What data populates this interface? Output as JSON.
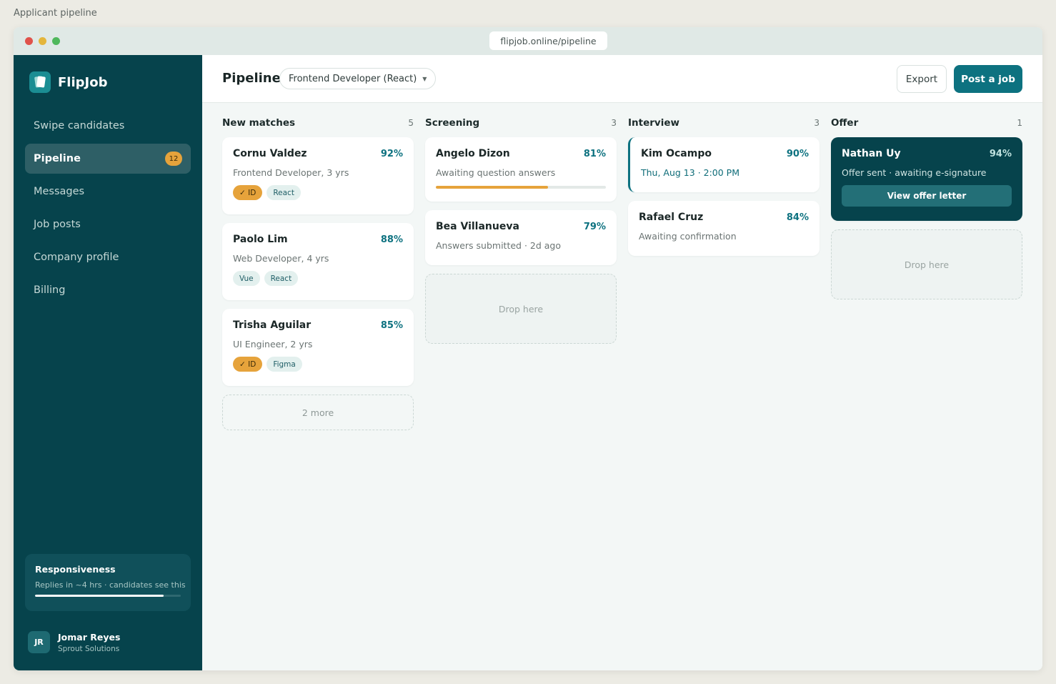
{
  "page_caption": "Applicant pipeline",
  "browser": {
    "url": "flipjob.online/pipeline"
  },
  "sidebar": {
    "brand": "FlipJob",
    "nav": [
      {
        "label": "Swipe candidates"
      },
      {
        "label": "Pipeline",
        "badge": "12",
        "active": true
      },
      {
        "label": "Messages"
      },
      {
        "label": "Job posts"
      },
      {
        "label": "Company profile"
      },
      {
        "label": "Billing"
      }
    ],
    "responsiveness": {
      "title": "Responsiveness",
      "subtitle": "Replies in ~4 hrs · candidates see this",
      "level_percent": 88
    },
    "user": {
      "initials": "JR",
      "name": "Jomar Reyes",
      "company": "Sprout Solutions"
    }
  },
  "header": {
    "title": "Pipeline",
    "job_filter": "Frontend Developer (React)",
    "export_label": "Export",
    "post_label": "Post a job"
  },
  "columns": {
    "new_matches": {
      "title": "New matches",
      "count": "5",
      "cards": [
        {
          "name": "Cornu Valdez",
          "score": "92%",
          "sub": "Frontend Developer, 3 yrs",
          "tags": [
            "✓ ID",
            "React"
          ]
        },
        {
          "name": "Paolo Lim",
          "score": "88%",
          "sub": "Web Developer, 4 yrs",
          "tags": [
            "Vue",
            "React"
          ]
        },
        {
          "name": "Trisha Aguilar",
          "score": "85%",
          "sub": "UI Engineer, 2 yrs",
          "tags": [
            "✓ ID",
            "Figma"
          ]
        }
      ],
      "more": "2 more"
    },
    "screening": {
      "title": "Screening",
      "count": "3",
      "cards": [
        {
          "name": "Angelo Dizon",
          "score": "81%",
          "sub": "Awaiting question answers",
          "progress_percent": 66
        },
        {
          "name": "Bea Villanueva",
          "score": "79%",
          "sub": "Answers submitted · 2d ago"
        }
      ],
      "drop": "Drop here"
    },
    "interview": {
      "title": "Interview",
      "count": "3",
      "cards": [
        {
          "name": "Kim Ocampo",
          "score": "90%",
          "sub": "Thu, Aug 13 · 2:00 PM"
        },
        {
          "name": "Rafael Cruz",
          "score": "84%",
          "sub": "Awaiting confirmation"
        }
      ]
    },
    "offer": {
      "title": "Offer",
      "count": "1",
      "cards": [
        {
          "name": "Nathan Uy",
          "score": "94%",
          "sub": "Offer sent · awaiting e-signature",
          "button": "View offer letter"
        }
      ],
      "drop": "Drop here"
    }
  },
  "colors": {
    "sidebar_bg": "#06434c",
    "accent": "#0d7280",
    "badge": "#e6a33b"
  }
}
